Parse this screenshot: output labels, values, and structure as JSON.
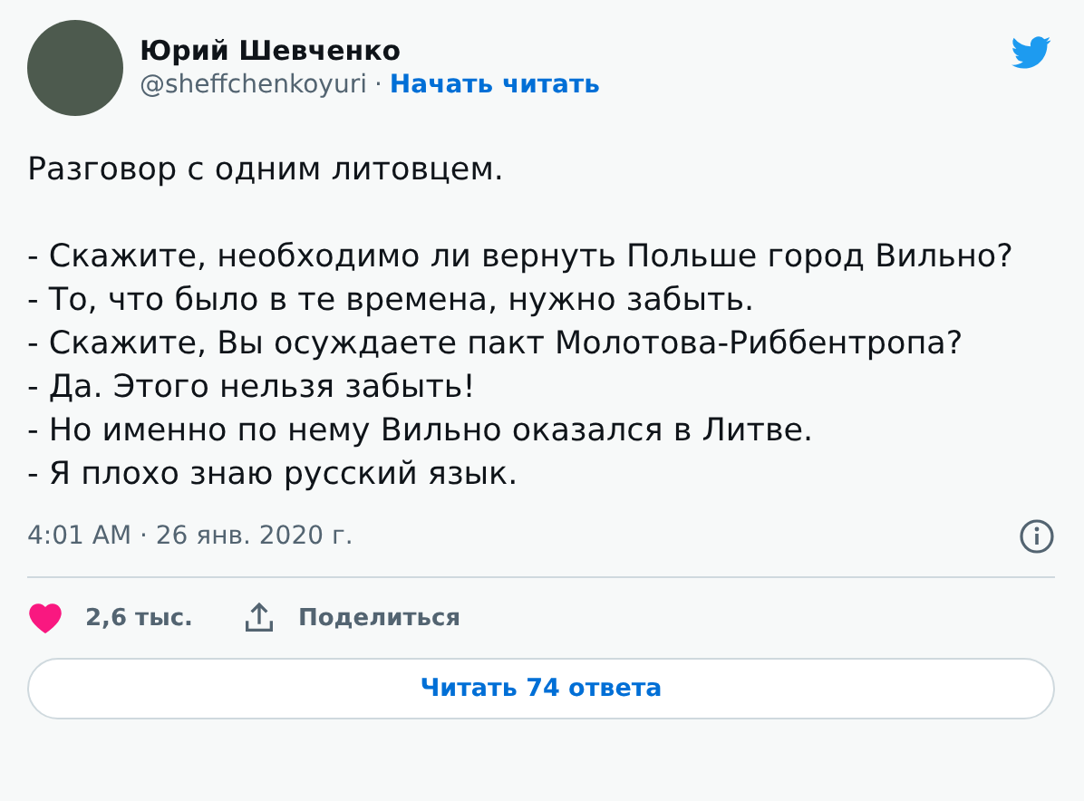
{
  "author": {
    "name": "Юрий Шевченко",
    "handle": "@sheffchenkoyuri",
    "separator": "·",
    "follow_link": "Начать читать"
  },
  "tweet": {
    "intro": "Разговор с одним литовцем.",
    "lines": [
      "- Скажите, необходимо ли вернуть Польше город Вильно?",
      "- То, что было в те времена, нужно забыть.",
      "- Скажите, Вы осуждаете пакт Молотова-Риббентропа?",
      "- Да. Этого нельзя забыть!",
      "- Но именно по нему Вильно оказался в Литве.",
      "- Я плохо знаю русский язык."
    ],
    "timestamp": "4:01 AM · 26 янв. 2020 г."
  },
  "actions": {
    "like": {
      "count": "2,6 тыс.",
      "liked": true
    },
    "share": {
      "label": "Поделиться"
    }
  },
  "replies_button": "Читать 74 ответа"
}
